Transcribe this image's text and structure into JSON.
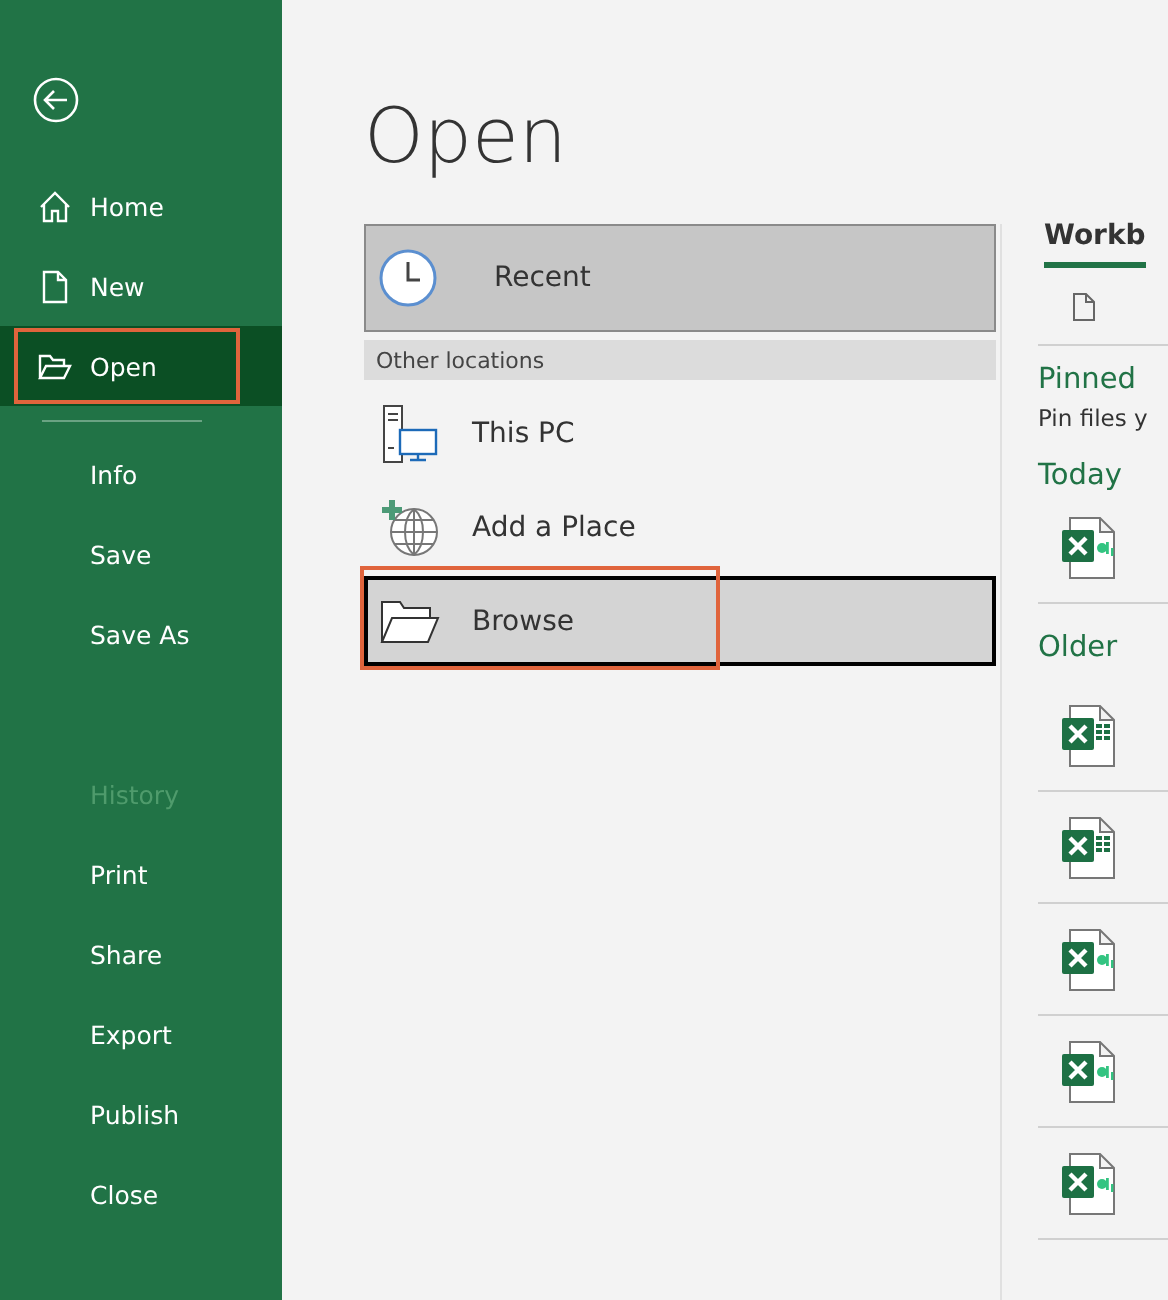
{
  "sidebar": {
    "items": [
      {
        "label": "Home",
        "selected": false,
        "disabled": false,
        "highlighted": false,
        "divider_before": false,
        "gap_before": false
      },
      {
        "label": "New",
        "selected": false,
        "disabled": false,
        "highlighted": false,
        "divider_before": false,
        "gap_before": false
      },
      {
        "label": "Open",
        "selected": true,
        "disabled": false,
        "highlighted": true,
        "divider_before": false,
        "gap_before": false
      },
      {
        "label": "Info",
        "selected": false,
        "disabled": false,
        "highlighted": false,
        "divider_before": true,
        "gap_before": false
      },
      {
        "label": "Save",
        "selected": false,
        "disabled": false,
        "highlighted": false,
        "divider_before": false,
        "gap_before": false
      },
      {
        "label": "Save As",
        "selected": false,
        "disabled": false,
        "highlighted": false,
        "divider_before": false,
        "gap_before": false
      },
      {
        "label": "History",
        "selected": false,
        "disabled": true,
        "highlighted": false,
        "divider_before": false,
        "gap_before": true
      },
      {
        "label": "Print",
        "selected": false,
        "disabled": false,
        "highlighted": false,
        "divider_before": false,
        "gap_before": false
      },
      {
        "label": "Share",
        "selected": false,
        "disabled": false,
        "highlighted": false,
        "divider_before": false,
        "gap_before": false
      },
      {
        "label": "Export",
        "selected": false,
        "disabled": false,
        "highlighted": false,
        "divider_before": false,
        "gap_before": false
      },
      {
        "label": "Publish",
        "selected": false,
        "disabled": false,
        "highlighted": false,
        "divider_before": false,
        "gap_before": false
      },
      {
        "label": "Close",
        "selected": false,
        "disabled": false,
        "highlighted": false,
        "divider_before": false,
        "gap_before": false
      }
    ]
  },
  "page_title": "Open",
  "locations": [
    {
      "kind": "recent",
      "label": "Recent",
      "selected": true,
      "focused": false,
      "highlighted": false
    },
    {
      "kind": "header",
      "label": "Other locations"
    },
    {
      "kind": "computer",
      "label": "This PC",
      "selected": false,
      "focused": false,
      "highlighted": false
    },
    {
      "kind": "place",
      "label": "Add a Place",
      "selected": false,
      "focused": false,
      "highlighted": false
    },
    {
      "kind": "browse",
      "label": "Browse",
      "selected": false,
      "focused": true,
      "highlighted": true
    }
  ],
  "files_panel": {
    "tab": "Workb",
    "sections": [
      {
        "title": "Pinned",
        "note": "Pin files y"
      },
      {
        "title": "Today",
        "files": [
          {
            "kind": "text"
          }
        ]
      },
      {
        "title": "Older",
        "files": [
          {
            "kind": "grid"
          },
          {
            "kind": "grid"
          },
          {
            "kind": "text"
          },
          {
            "kind": "text"
          },
          {
            "kind": "text"
          }
        ]
      }
    ]
  }
}
